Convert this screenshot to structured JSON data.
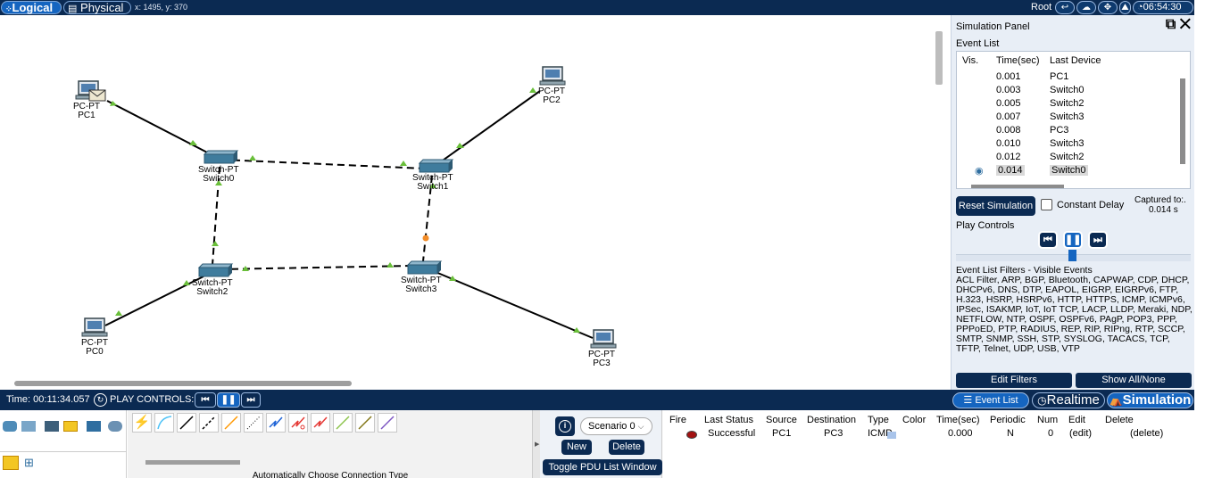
{
  "topbar": {
    "logical_label": "Logical",
    "physical_label": "Physical",
    "coords": "x: 1495, y: 370",
    "user_label": "Root",
    "clock": "06:54:30"
  },
  "topology": {
    "devices": [
      {
        "id": "pc1",
        "type": "PC-PT",
        "name": "PC1"
      },
      {
        "id": "pc2",
        "type": "PC-PT",
        "name": "PC2"
      },
      {
        "id": "pc0",
        "type": "PC-PT",
        "name": "PC0"
      },
      {
        "id": "pc3",
        "type": "PC-PT",
        "name": "PC3"
      },
      {
        "id": "sw0",
        "type": "Switch-PT",
        "name": "Switch0"
      },
      {
        "id": "sw1",
        "type": "Switch-PT",
        "name": "Switch1"
      },
      {
        "id": "sw2",
        "type": "Switch-PT",
        "name": "Switch2"
      },
      {
        "id": "sw3",
        "type": "Switch-PT",
        "name": "Switch3"
      }
    ]
  },
  "sim_panel": {
    "title": "Simulation Panel",
    "event_list_label": "Event List",
    "columns": [
      "Vis.",
      "Time(sec)",
      "Last Device"
    ],
    "events": [
      {
        "time": "0.001",
        "device": "PC1"
      },
      {
        "time": "0.003",
        "device": "Switch0"
      },
      {
        "time": "0.005",
        "device": "Switch2"
      },
      {
        "time": "0.007",
        "device": "Switch3"
      },
      {
        "time": "0.008",
        "device": "PC3"
      },
      {
        "time": "0.010",
        "device": "Switch3"
      },
      {
        "time": "0.012",
        "device": "Switch2"
      },
      {
        "time": "0.014",
        "device": "Switch0"
      }
    ],
    "reset_label": "Reset Simulation",
    "constant_delay_label": "Constant Delay",
    "captured_label": "Captured to:.",
    "captured_value": "0.014 s",
    "play_controls_label": "Play Controls",
    "filters_text": "Event List Filters - Visible Events\nACL Filter, ARP, BGP, Bluetooth, CAPWAP, CDP, DHCP, DHCPv6, DNS, DTP, EAPOL, EIGRP, EIGRPv6, FTP, H.323, HSRP, HSRPv6, HTTP, HTTPS, ICMP, ICMPv6, IPSec, ISAKMP, IoT, IoT TCP, LACP, LLDP, Meraki, NDP, NETFLOW, NTP, OSPF, OSPFv6, PAgP, POP3, PPP, PPPoED, PTP, RADIUS, REP, RIP, RIPng, RTP, SCCP, SMTP, SNMP, SSH, STP, SYSLOG, TACACS, TCP, TFTP, Telnet, UDP, USB, VTP",
    "edit_filters_label": "Edit Filters",
    "show_all_label": "Show All/None"
  },
  "timebar": {
    "time_text": "Time: 00:11:34.057",
    "play_controls": "PLAY CONTROLS:",
    "event_list_tab": "Event List",
    "realtime_tab": "Realtime",
    "simulation_tab": "Simulation"
  },
  "bottom": {
    "connection_label": "Automatically Choose Connection Type",
    "scenario_value": "Scenario 0",
    "new_label": "New",
    "delete_label": "Delete",
    "toggle_pdu_label": "Toggle PDU List Window",
    "pdu_columns": [
      "Fire",
      "Last Status",
      "Source",
      "Destination",
      "Type",
      "Color",
      "Time(sec)",
      "Periodic",
      "Num",
      "Edit",
      "Delete"
    ],
    "pdu_row": {
      "status": "Successful",
      "source": "PC1",
      "destination": "PC3",
      "type": "ICMP",
      "time": "0.000",
      "periodic": "N",
      "num": "0",
      "edit": "(edit)",
      "delete": "(delete)"
    }
  },
  "colors": {
    "navy": "#0b2a52",
    "accent": "#1565c0",
    "link_green": "#6abf3a",
    "pdu_color": "#a9c4ea"
  }
}
